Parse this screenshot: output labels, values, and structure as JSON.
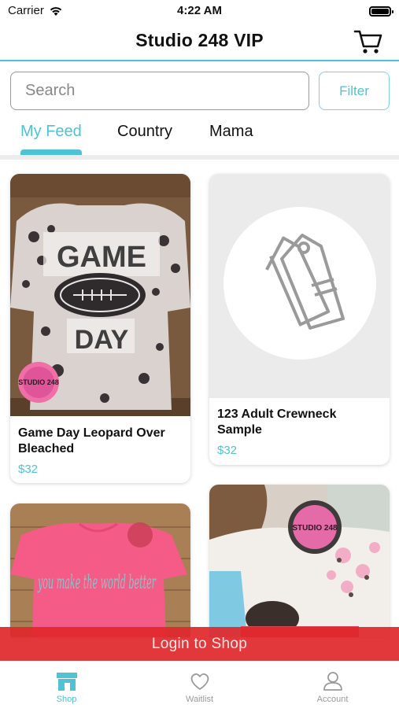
{
  "status_bar": {
    "carrier": "Carrier",
    "time": "4:22 AM"
  },
  "header": {
    "title": "Studio 248 VIP"
  },
  "search": {
    "placeholder": "Search",
    "filter_label": "Filter"
  },
  "feed_tabs": [
    {
      "label": "My Feed",
      "active": true
    },
    {
      "label": "Country",
      "active": false
    },
    {
      "label": "Mama",
      "active": false
    }
  ],
  "products": [
    {
      "name": "Game Day Leopard Over Bleached",
      "price": "$32",
      "image": "game-day-sweatshirt-photo",
      "badge_text": "STUDIO 248"
    },
    {
      "name": "123 Adult Crewneck Sample",
      "price": "$32",
      "image": "price-tag-placeholder-icon"
    },
    {
      "name": "",
      "price": "",
      "image": "pink-tshirt-photo",
      "shirt_text": "you make the world better"
    },
    {
      "name": "",
      "price": "",
      "image": "leopard-sweatshirt-photo",
      "badge_text": "STUDIO 248"
    }
  ],
  "login_banner": {
    "label": "Login to Shop"
  },
  "tab_bar": [
    {
      "label": "Shop",
      "icon": "shop-icon",
      "active": true
    },
    {
      "label": "Waitlist",
      "icon": "heart-icon",
      "active": false
    },
    {
      "label": "Account",
      "icon": "account-icon",
      "active": false
    }
  ],
  "colors": {
    "accent": "#4fc3d3",
    "banner": "#e0272b"
  }
}
